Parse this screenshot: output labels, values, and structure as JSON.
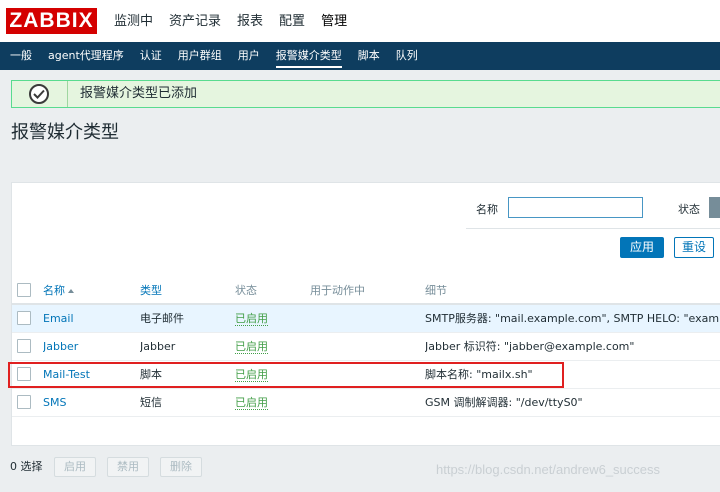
{
  "app": {
    "logo": "ZABBIX"
  },
  "main_menu": [
    {
      "label": "监测中"
    },
    {
      "label": "资产记录"
    },
    {
      "label": "报表"
    },
    {
      "label": "配置"
    },
    {
      "label": "管理",
      "active": true
    }
  ],
  "sub_menu": [
    {
      "label": "一般"
    },
    {
      "label": "agent代理程序"
    },
    {
      "label": "认证"
    },
    {
      "label": "用户群组"
    },
    {
      "label": "用户"
    },
    {
      "label": "报警媒介类型",
      "active": true
    },
    {
      "label": "脚本"
    },
    {
      "label": "队列"
    }
  ],
  "message": {
    "text": "报警媒介类型已添加",
    "type": "success"
  },
  "page_title": "报警媒介类型",
  "filter": {
    "name_label": "名称",
    "name_value": "",
    "status_label": "状态",
    "apply_label": "应用",
    "reset_label": "重设"
  },
  "table": {
    "headers": {
      "name": "名称",
      "type": "类型",
      "status": "状态",
      "used_in": "用于动作中",
      "details": "细节"
    },
    "sort": {
      "column": "name",
      "direction": "asc"
    },
    "rows": [
      {
        "name": "Email",
        "type": "电子邮件",
        "status": "已启用",
        "used_in": "",
        "details": "SMTP服务器: \"mail.example.com\", SMTP HELO: \"example.com\"",
        "highlighted": true
      },
      {
        "name": "Jabber",
        "type": "Jabber",
        "status": "已启用",
        "used_in": "",
        "details": "Jabber 标识符: \"jabber@example.com\"",
        "highlighted": false
      },
      {
        "name": "Mail-Test",
        "type": "脚本",
        "status": "已启用",
        "used_in": "",
        "details": "脚本名称: \"mailx.sh\"",
        "highlighted": false
      },
      {
        "name": "SMS",
        "type": "短信",
        "status": "已启用",
        "used_in": "",
        "details": "GSM 调制解调器: \"/dev/ttyS0\"",
        "highlighted": false
      }
    ]
  },
  "footer": {
    "selected_count": "0 选择",
    "enable_label": "启用",
    "disable_label": "禁用",
    "delete_label": "删除"
  },
  "watermark": "https://blog.csdn.net/andrew6_success",
  "colors": {
    "brand": "#d40000",
    "nav": "#0e3d5f",
    "link": "#0275b8",
    "enabled": "#429e47",
    "highlight_box": "#e02020"
  }
}
